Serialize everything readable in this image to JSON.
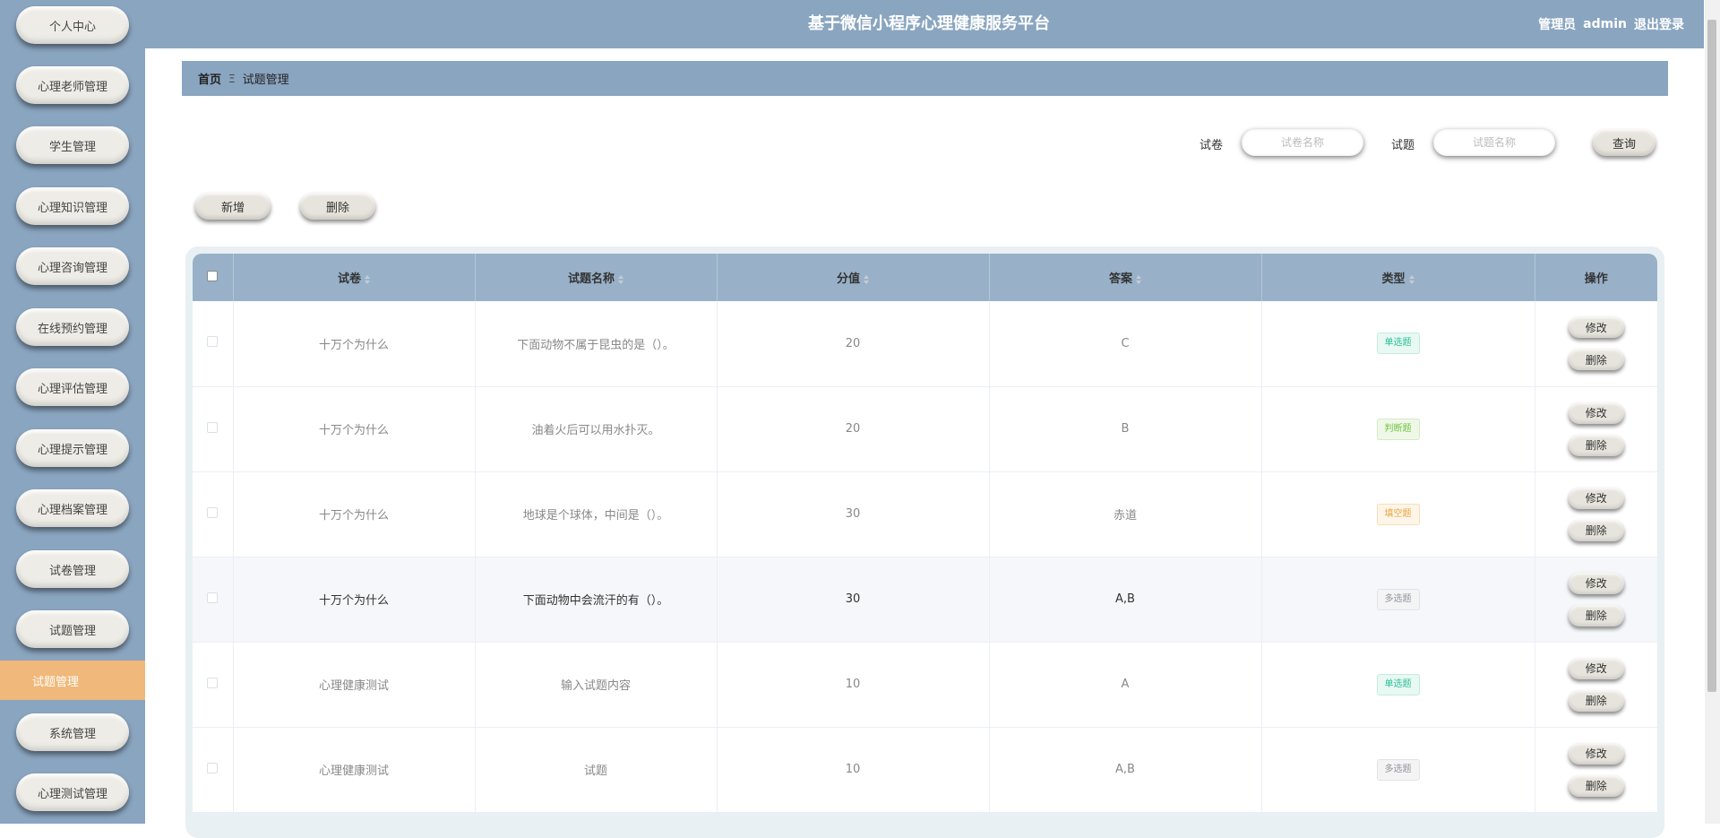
{
  "header": {
    "title": "基于微信小程序心理健康服务平台",
    "role_label": "管理员",
    "username": "admin",
    "logout_label": "退出登录"
  },
  "sidebar": {
    "items": [
      {
        "label": "个人中心"
      },
      {
        "label": "心理老师管理"
      },
      {
        "label": "学生管理"
      },
      {
        "label": "心理知识管理"
      },
      {
        "label": "心理咨询管理"
      },
      {
        "label": "在线预约管理"
      },
      {
        "label": "心理评估管理"
      },
      {
        "label": "心理提示管理"
      },
      {
        "label": "心理档案管理"
      },
      {
        "label": "试卷管理"
      },
      {
        "label": "试题管理"
      }
    ],
    "active_sub_item": "试题管理",
    "items_after": [
      {
        "label": "系统管理"
      },
      {
        "label": "心理测试管理"
      }
    ]
  },
  "breadcrumb": {
    "home": "首页",
    "separator": "Ξ",
    "current": "试题管理"
  },
  "search": {
    "paper_label": "试卷",
    "paper_placeholder": "试卷名称",
    "question_label": "试题",
    "question_placeholder": "试题名称",
    "query_button": "查询"
  },
  "actions": {
    "add_button": "新增",
    "delete_button": "删除"
  },
  "table": {
    "columns": [
      "试卷",
      "试题名称",
      "分值",
      "答案",
      "类型",
      "操作"
    ],
    "edit_label": "修改",
    "delete_label": "删除",
    "rows": [
      {
        "paper": "十万个为什么",
        "question": "下面动物不属于昆虫的是（）。",
        "score": "20",
        "answer": "C",
        "type": "单选题",
        "type_kind": "single"
      },
      {
        "paper": "十万个为什么",
        "question": "油着火后可以用水扑灭。",
        "score": "20",
        "answer": "B",
        "type": "判断题",
        "type_kind": "judge"
      },
      {
        "paper": "十万个为什么",
        "question": "地球是个球体，中间是（）。",
        "score": "30",
        "answer": "赤道",
        "type": "填空题",
        "type_kind": "fill"
      },
      {
        "paper": "十万个为什么",
        "question": "下面动物中会流汗的有（）。",
        "score": "30",
        "answer": "A,B",
        "type": "多选题",
        "type_kind": "multi"
      },
      {
        "paper": "心理健康测试",
        "question": "输入试题内容",
        "score": "10",
        "answer": "A",
        "type": "单选题",
        "type_kind": "single"
      },
      {
        "paper": "心理健康测试",
        "question": "试题",
        "score": "10",
        "answer": "A,B",
        "type": "多选题",
        "type_kind": "multi"
      }
    ]
  }
}
